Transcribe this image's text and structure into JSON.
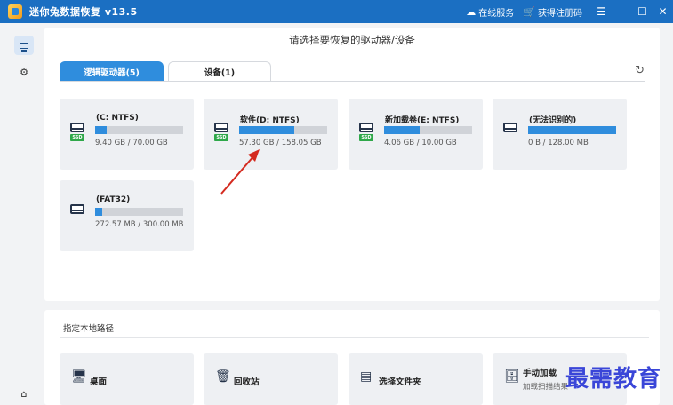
{
  "titlebar": {
    "title": "迷你兔数据恢复 v13.5",
    "online_service": "在线服务",
    "register": "获得注册码",
    "menu_icon": "menu-icon",
    "minimize_icon": "minimize-icon",
    "maximize_icon": "maximize-icon",
    "close_icon": "close-icon",
    "accent": "#1b6fc2"
  },
  "main": {
    "header": "请选择要恢复的驱动器/设备",
    "tabs": [
      {
        "label": "逻辑驱动器(5)",
        "active": true
      },
      {
        "label": "设备(1)",
        "active": false
      }
    ],
    "drives": [
      {
        "name": "(C: NTFS)",
        "size": "9.40 GB / 70.00 GB",
        "used_fraction": 0.134,
        "ssd": true
      },
      {
        "name": "软件(D: NTFS)",
        "size": "57.30 GB / 158.05 GB",
        "used_fraction": 0.63,
        "ssd": true
      },
      {
        "name": "新加载卷(E: NTFS)",
        "size": "4.06 GB / 10.00 GB",
        "used_fraction": 0.406,
        "ssd": true
      },
      {
        "name": "(无法识别的)",
        "size": "0 B / 128.00 MB",
        "used_fraction": 1.0,
        "ssd": false
      },
      {
        "name": "(FAT32)",
        "size": "272.57 MB / 300.00 MB",
        "used_fraction": 0.08,
        "ssd": false
      }
    ],
    "ssd_badge": "SSD"
  },
  "bottom": {
    "label": "指定本地路径",
    "items": [
      {
        "label": "桌面",
        "icon": "desktop-icon"
      },
      {
        "label": "回收站",
        "icon": "recycle-bin-icon"
      },
      {
        "label": "选择文件夹",
        "icon": "folder-icon"
      },
      {
        "label": "手动加载",
        "sub": "加载扫描结果",
        "icon": "manual-load-icon"
      }
    ]
  },
  "watermark": "最需教育"
}
